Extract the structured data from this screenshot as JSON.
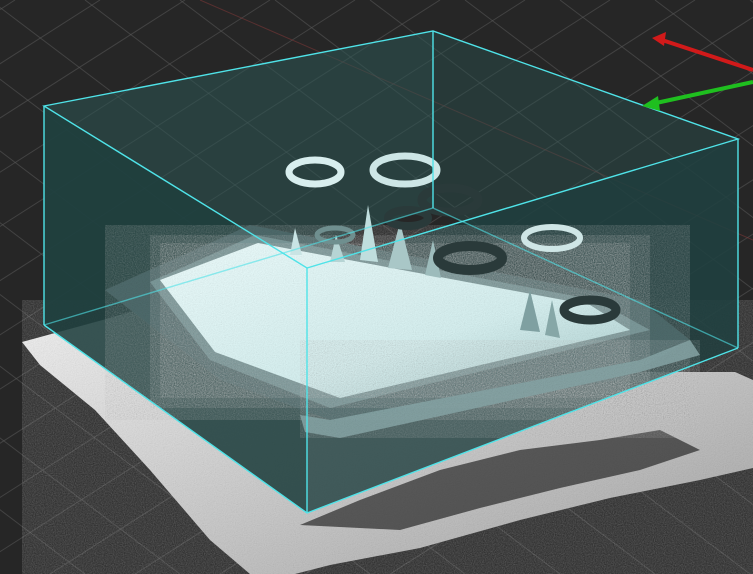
{
  "viewport": {
    "background_color": "#262626",
    "grid_color": "#5a5a5a",
    "bounding_box_edge_color": "#4fe3e8",
    "bounding_box_fill_color": "#2f7e7c",
    "point_cloud_colors": [
      "#f2f2f2",
      "#e6fbfb",
      "#9ec6c6",
      "#5f7f80",
      "#3a4f51"
    ],
    "axes": [
      {
        "name": "x",
        "color": "#d11a1a"
      },
      {
        "name": "y",
        "color": "#1fbf1f"
      }
    ]
  }
}
